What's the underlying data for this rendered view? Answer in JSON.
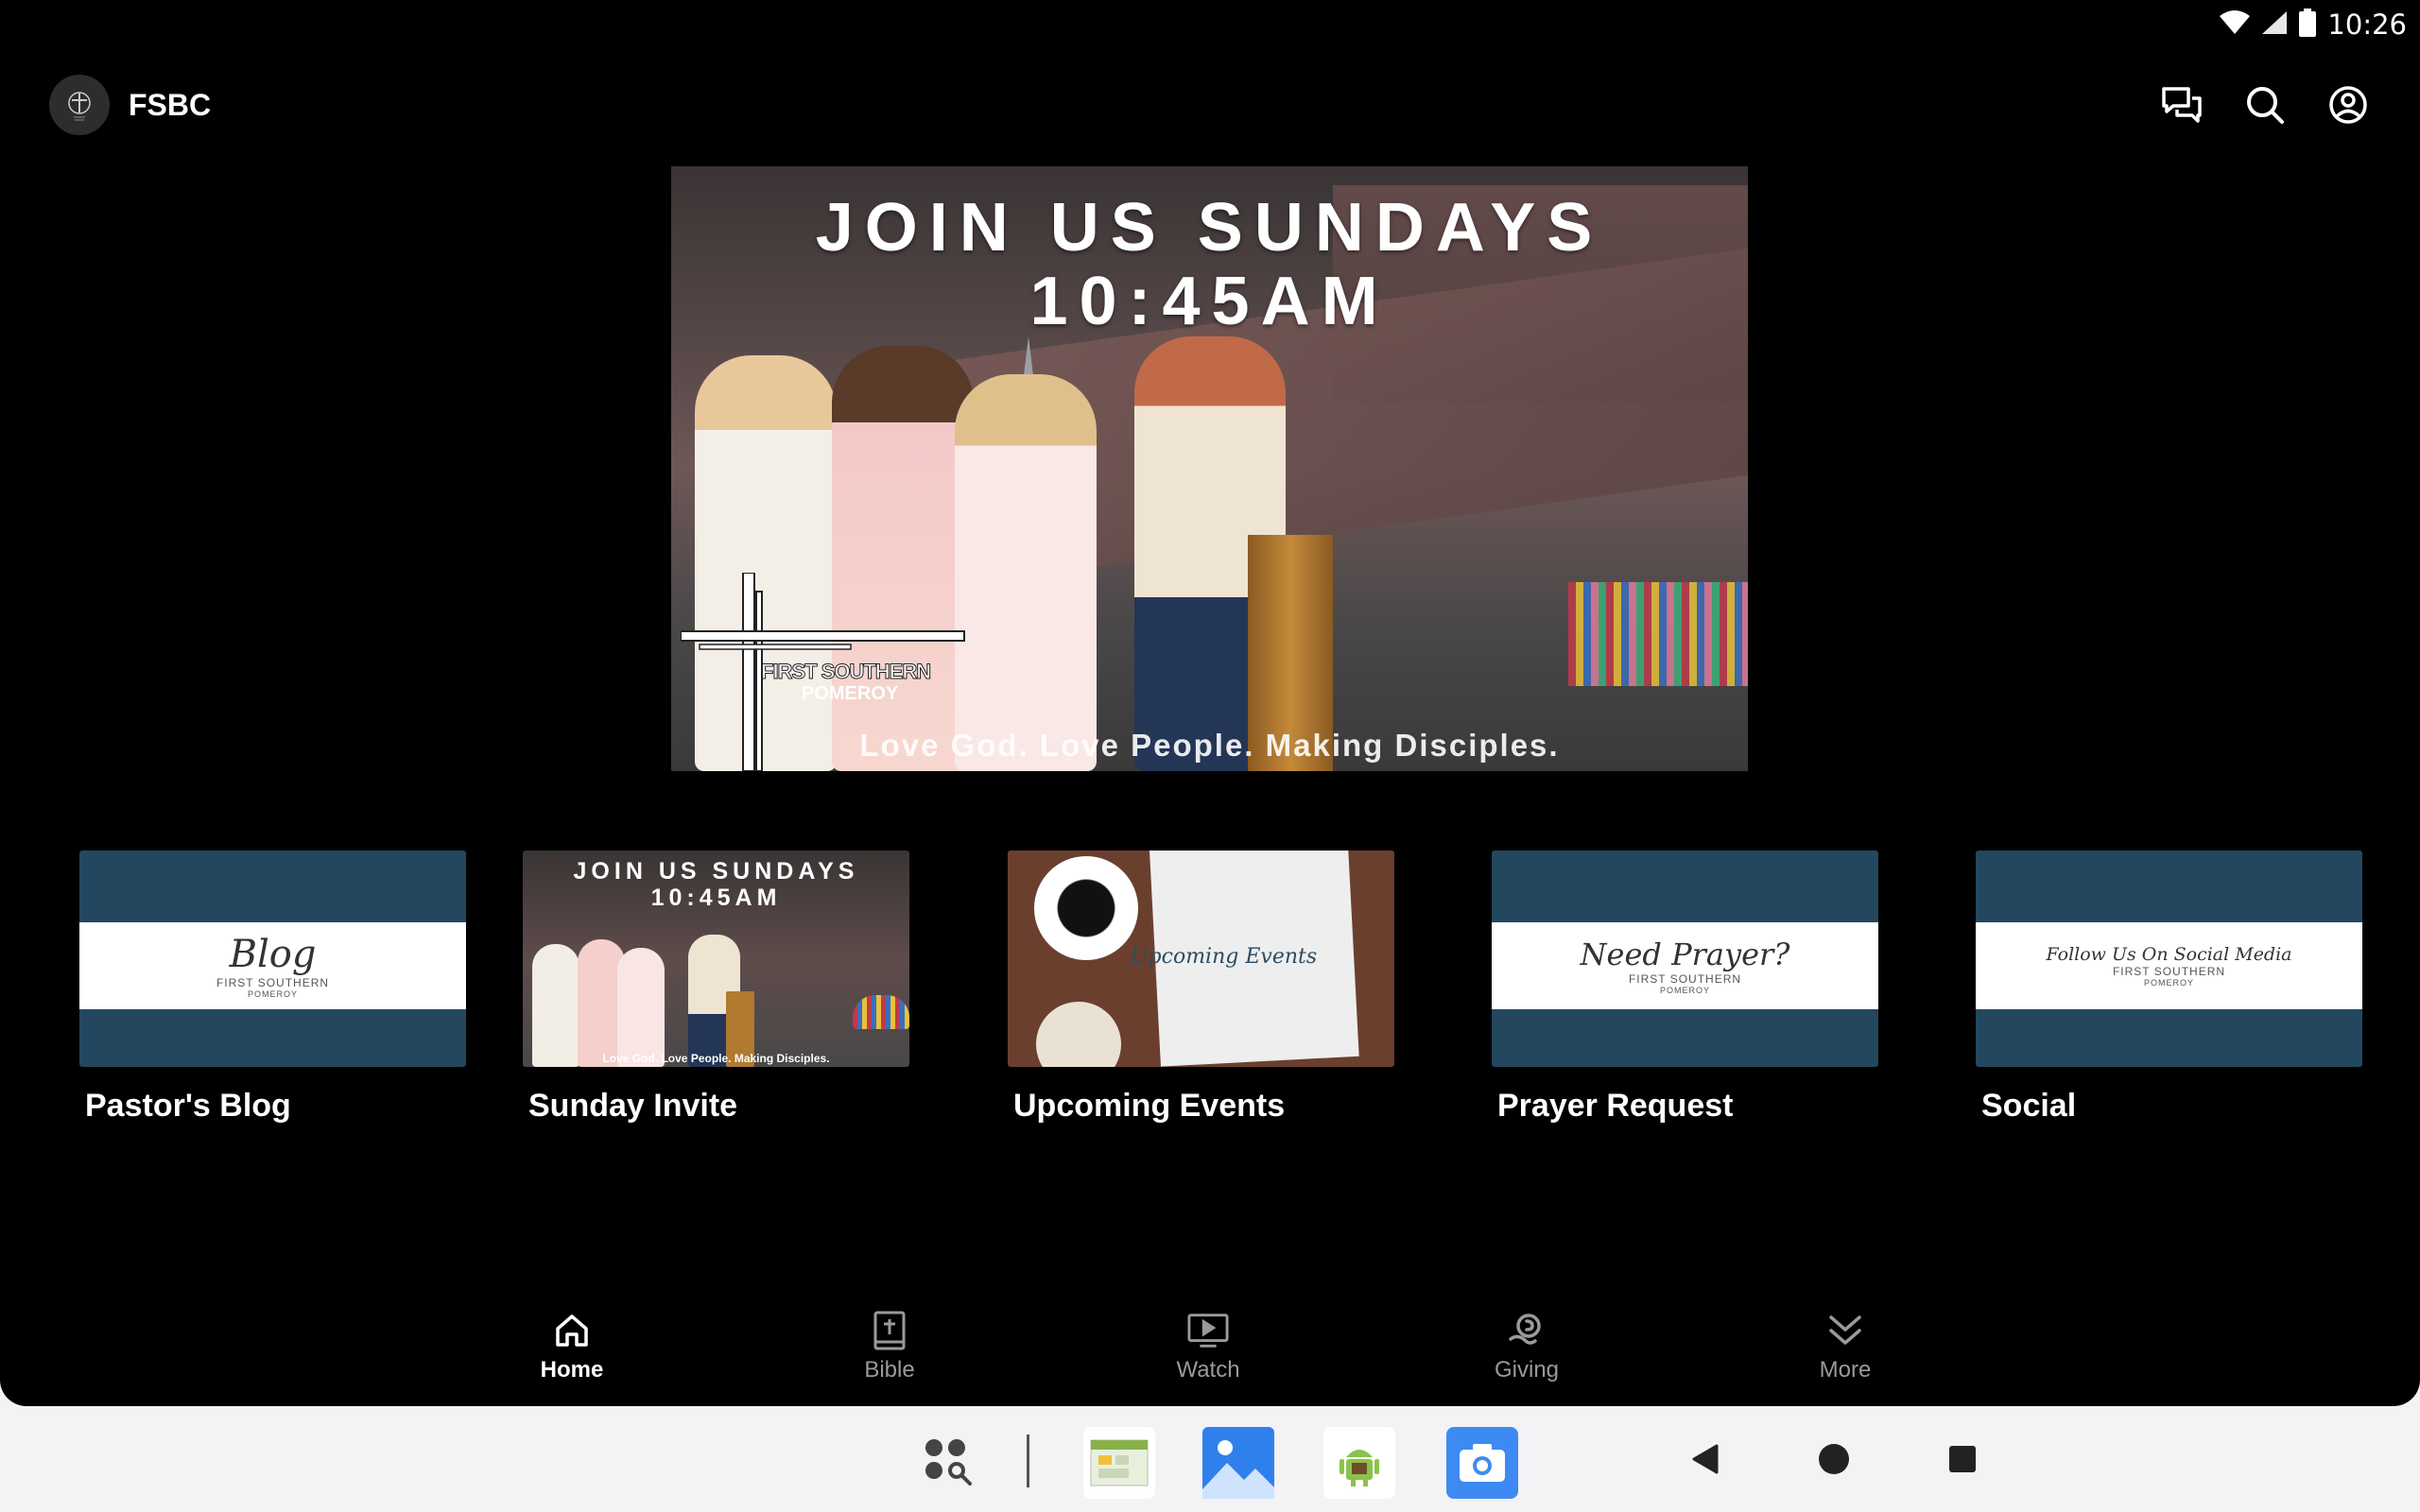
{
  "status_bar": {
    "time": "10:26"
  },
  "app": {
    "title": "FSBC"
  },
  "hero": {
    "headline_line1": "JOIN US SUNDAYS",
    "headline_line2": "10:45AM",
    "logo_line1": "FIRST SOUTHERN",
    "logo_line2": "POMEROY",
    "tagline": "Love God. Love People. Making Disciples."
  },
  "cards": [
    {
      "label": "Pastor's Blog",
      "script": "Blog",
      "sub1": "FIRST SOUTHERN",
      "sub2": "POMEROY"
    },
    {
      "label": "Sunday Invite",
      "line1": "JOIN US SUNDAYS",
      "line2": "10:45AM",
      "tagline": "Love God. Love People. Making Disciples."
    },
    {
      "label": "Upcoming Events",
      "script": "Upcoming Events"
    },
    {
      "label": "Prayer Request",
      "script": "Need Prayer?",
      "sub1": "FIRST SOUTHERN",
      "sub2": "POMEROY"
    },
    {
      "label": "Social",
      "script": "Follow Us On Social Media",
      "sub1": "FIRST SOUTHERN",
      "sub2": "POMEROY"
    }
  ],
  "bottom_nav": [
    {
      "label": "Home",
      "icon": "home-icon",
      "active": true
    },
    {
      "label": "Bible",
      "icon": "bible-icon"
    },
    {
      "label": "Watch",
      "icon": "watch-icon"
    },
    {
      "label": "Giving",
      "icon": "giving-icon"
    },
    {
      "label": "More",
      "icon": "more-icon"
    }
  ],
  "colors": {
    "card_blue": "#23475e",
    "background": "#000000",
    "inactive_nav": "#9a9a9a"
  }
}
